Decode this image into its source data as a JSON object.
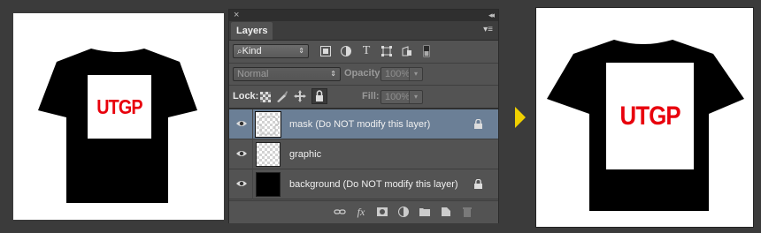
{
  "preview": {
    "print_text": "UTGP"
  },
  "panel": {
    "close_glyph": "×",
    "collapse_glyph": "◂◂",
    "tab_label": "Layers",
    "menu_glyph": "▾≡",
    "filter": {
      "kind_label": "Kind",
      "icons": [
        "image-filter-icon",
        "adjustment-filter-icon",
        "type-filter-icon",
        "shape-filter-icon",
        "smart-object-filter-icon",
        "filter-toggle-icon"
      ],
      "type_glyph": "T"
    },
    "blend": {
      "mode": "Normal",
      "opacity_label": "Opacity:",
      "opacity_value": "100%"
    },
    "lock": {
      "label": "Lock:",
      "fill_label": "Fill:",
      "fill_value": "100%",
      "icons": [
        "lock-transparent-icon",
        "lock-image-icon",
        "lock-position-icon",
        "lock-all-icon"
      ]
    },
    "layers": [
      {
        "name": "mask (Do NOT modify this layer)",
        "selected": true,
        "locked": true,
        "thumb": "mask"
      },
      {
        "name": "graphic",
        "selected": false,
        "locked": false,
        "thumb": "transparent"
      },
      {
        "name": "background (Do NOT modify this layer)",
        "selected": false,
        "locked": true,
        "thumb": "black"
      }
    ],
    "bottom_icons": [
      "link-layers-icon",
      "layer-style-icon",
      "add-mask-icon",
      "adjustment-layer-icon",
      "new-group-icon",
      "new-layer-icon",
      "delete-layer-icon"
    ],
    "fx_glyph": "fx"
  },
  "colors": {
    "panel_bg": "#535353",
    "selected_row": "#6b7f96",
    "print_red": "#e8000c",
    "arrow": "#f0d000"
  }
}
